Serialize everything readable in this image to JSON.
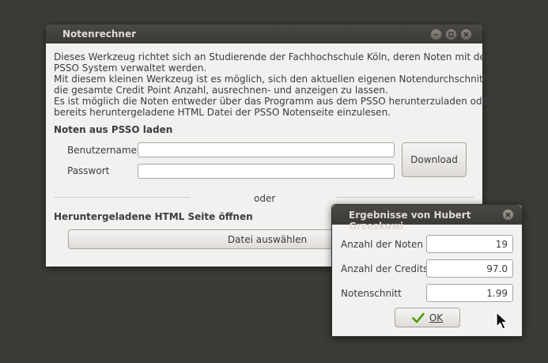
{
  "main_window": {
    "title": "Notenrechner",
    "description": [
      "Dieses Werkzeug richtet sich an Studierende der Fachhochschule Köln, deren Noten mit dem",
      "PSSO System verwaltet werden.",
      "Mit diesem kleinen Werkzeug ist es möglich, sich den aktuellen eigenen Notendurchschnitt, sowie",
      "die gesamte Credit Point Anzahl, ausrechnen- und anzeigen zu lassen.",
      "Es ist möglich die Noten entweder über das Programm aus dem PSSO herunterzuladen oder eine",
      "bereits heruntergeladene HTML Datei der PSSO Notenseite einzulesen."
    ],
    "psso_heading": "Noten aus PSSO laden",
    "username_label": "Benutzername",
    "username_value": "",
    "password_label": "Passwort",
    "password_value": "",
    "download_label": "Download",
    "or_label": "oder",
    "html_heading": "Heruntergeladene HTML Seite öffnen",
    "file_button_label": "Datei auswählen"
  },
  "results_dialog": {
    "title": "Ergebnisse von Hubert Grzeskowi",
    "rows": [
      {
        "label": "Anzahl der Noten",
        "value": "19"
      },
      {
        "label": "Anzahl der Credits",
        "value": "97.0"
      },
      {
        "label": "Notenschnitt",
        "value": "1.99"
      }
    ],
    "ok_label": "OK"
  },
  "colors": {
    "desktop": "#3c3b37",
    "window_bg": "#f2f1f0",
    "titlebar": "#3b3a36",
    "ok_check": "#4e9a06"
  },
  "icons": {
    "close": "close-icon",
    "minimize": "minimize-icon",
    "maximize": "maximize-icon",
    "ok": "checkmark-icon",
    "cursor": "mouse-pointer-icon"
  }
}
